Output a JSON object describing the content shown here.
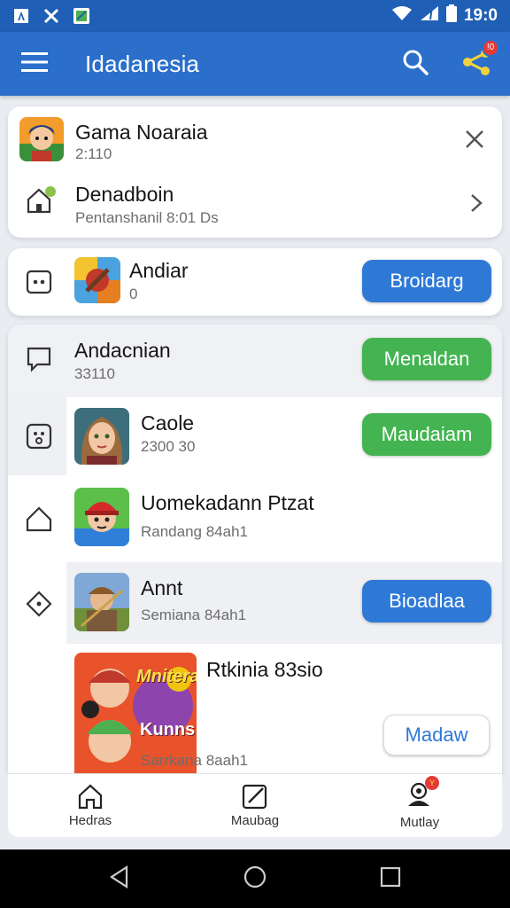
{
  "status_bar": {
    "time": "19:0"
  },
  "app_bar": {
    "title": "Idadanesia",
    "share_badge": "!0"
  },
  "top_card": {
    "item1": {
      "title": "Gama Noaraia",
      "subtitle": "2:110"
    },
    "item2": {
      "title": "Denadboin",
      "subtitle": "Pentanshanil 8:01 Ds"
    }
  },
  "card2": {
    "title": "Andiar",
    "subtitle": "0",
    "button": "Broidarg"
  },
  "list": [
    {
      "title": "Andacnian",
      "subtitle": "33110",
      "button": "Menaldan",
      "button_style": "green"
    },
    {
      "title": "Caole",
      "subtitle": "2300 30",
      "button": "Maudaiam",
      "button_style": "green"
    },
    {
      "title": "Uomekadann Ptzat",
      "subtitle": "Randang 84ah1",
      "button": "",
      "button_style": ""
    },
    {
      "title": "Annt",
      "subtitle": "Semiana 84ah1",
      "button": "Bioadlaa",
      "button_style": "blue"
    },
    {
      "title": "Rtkinia 83sio",
      "subtitle": "Sarrkana 8aah1",
      "button": "Madaw",
      "button_style": "outline"
    }
  ],
  "promo_art_text": {
    "line1": "Mnitera",
    "line2": "Kunns"
  },
  "bottom_nav": [
    {
      "label": "Hedras",
      "icon": "home-icon"
    },
    {
      "label": "Maubag",
      "icon": "edit-icon"
    },
    {
      "label": "Mutlay",
      "icon": "profile-icon",
      "badge": "Y"
    }
  ]
}
